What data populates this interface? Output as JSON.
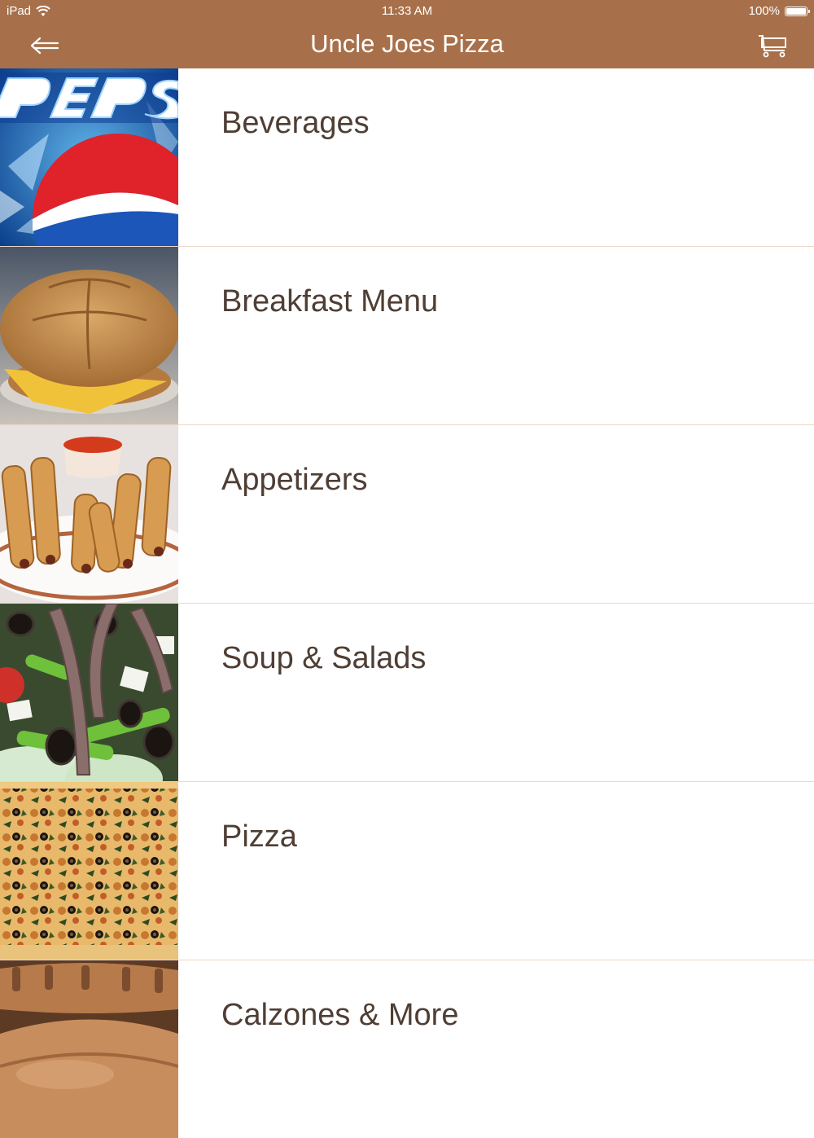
{
  "status": {
    "device": "iPad",
    "time": "11:33 AM",
    "battery": "100%"
  },
  "header": {
    "title": "Uncle Joes Pizza",
    "back_icon": "back-arrow-icon",
    "cart_icon": "cart-icon"
  },
  "colors": {
    "bar": "#a8704a",
    "label": "#4f3e34",
    "divider": "#ecd6c8"
  },
  "menu": {
    "items": [
      {
        "label": "Beverages",
        "image": "pepsi-image"
      },
      {
        "label": "Breakfast Menu",
        "image": "breakfast-sandwich-image"
      },
      {
        "label": "Appetizers",
        "image": "taquitos-image"
      },
      {
        "label": "Soup & Salads",
        "image": "salad-image"
      },
      {
        "label": "Pizza",
        "image": "pizza-image"
      },
      {
        "label": "Calzones & More",
        "image": "calzone-image"
      }
    ]
  }
}
